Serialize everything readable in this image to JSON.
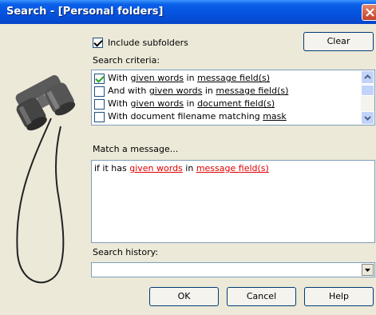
{
  "window": {
    "title": "Search - [Personal folders]"
  },
  "options": {
    "include_subfolders_label": "Include subfolders",
    "include_subfolders_checked": true,
    "clear_label": "Clear"
  },
  "criteria": {
    "label": "Search criteria:",
    "items": [
      {
        "checked": true,
        "parts": [
          "With ",
          "given words",
          " in ",
          "message field(s)"
        ]
      },
      {
        "checked": false,
        "parts": [
          "And with ",
          "given words",
          " in ",
          "message field(s)"
        ]
      },
      {
        "checked": false,
        "parts": [
          "With ",
          "given words",
          " in ",
          "document field(s)"
        ]
      },
      {
        "checked": false,
        "parts": [
          "With document filename matching ",
          "mask"
        ]
      }
    ]
  },
  "match": {
    "label": "Match a message...",
    "parts": [
      "if it has ",
      "given words",
      " in ",
      "message field(s)"
    ]
  },
  "history": {
    "label": "Search history:",
    "value": ""
  },
  "buttons": {
    "ok": "OK",
    "cancel": "Cancel",
    "help": "Help"
  },
  "icons": {
    "close": "close-icon",
    "binoculars": "binoculars-icon",
    "scroll_up": "scroll-up-arrow-icon",
    "scroll_down": "scroll-down-arrow-icon",
    "dropdown": "dropdown-arrow-icon"
  }
}
